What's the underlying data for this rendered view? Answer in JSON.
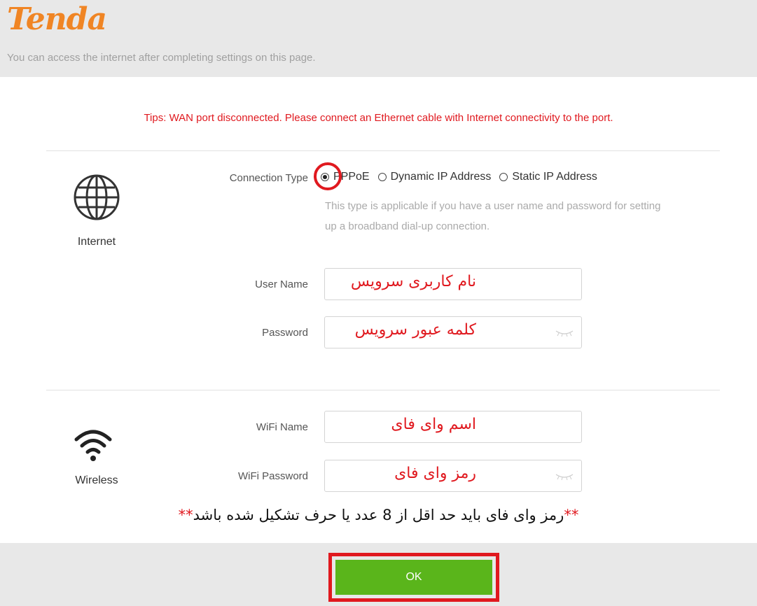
{
  "header": {
    "logo": "Tenda",
    "subtitle": "You can access the internet after completing settings on this page."
  },
  "tips": "Tips: WAN port disconnected. Please connect an Ethernet cable with Internet connectivity to the port.",
  "internet": {
    "section_label": "Internet",
    "section_icon": "globe-icon",
    "connection_type_label": "Connection Type",
    "options": [
      "PPPoE",
      "Dynamic IP Address",
      "Static IP Address"
    ],
    "selected": "PPPoE",
    "description": "This type is applicable if you have a user name and password for setting up a broadband dial-up connection.",
    "user_name_label": "User Name",
    "user_name_value": "نام کاربری سرویس",
    "password_label": "Password",
    "password_value": "کلمه عبور سرویس"
  },
  "wireless": {
    "section_label": "Wireless",
    "section_icon": "wifi-icon",
    "wifi_name_label": "WiFi Name",
    "wifi_name_value": "اسم وای فای",
    "wifi_password_label": "WiFi Password",
    "wifi_password_value": "رمز وای فای"
  },
  "note": {
    "stars": "**",
    "text": "رمز وای فای باید حد اقل از 8 عدد یا حرف تشکیل شده باشد"
  },
  "footer": {
    "ok_label": "OK"
  },
  "colors": {
    "brand_orange": "#f08524",
    "alert_red": "#e0191f",
    "ok_green": "#5ab51b"
  }
}
